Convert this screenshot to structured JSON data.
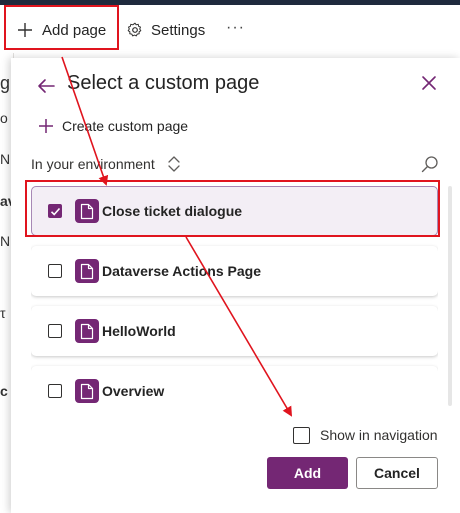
{
  "command_bar": {
    "add_page_label": "Add page",
    "settings_label": "Settings",
    "more_label": "···",
    "icons": {
      "add": "plus-icon",
      "settings": "gear-icon",
      "more": "ellipsis-icon"
    }
  },
  "background_fragments": [
    "g",
    "o",
    "N",
    "av",
    "N",
    "",
    "τ",
    "",
    "c"
  ],
  "panel": {
    "title": "Select a custom page",
    "create_label": "Create custom page",
    "environment_label": "In your environment",
    "icons": {
      "back": "back-arrow-icon",
      "close": "close-icon",
      "create": "plus-icon",
      "sort": "sort-icon",
      "search": "search-icon",
      "page": "page-icon"
    },
    "pages": [
      {
        "label": "Close ticket dialogue",
        "checked": true
      },
      {
        "label": "Dataverse Actions Page",
        "checked": false
      },
      {
        "label": "HelloWorld",
        "checked": false
      },
      {
        "label": "Overview",
        "checked": false
      }
    ],
    "show_in_navigation_label": "Show in navigation",
    "show_in_navigation_checked": false,
    "add_button_label": "Add",
    "cancel_button_label": "Cancel"
  },
  "colors": {
    "accent": "#742774",
    "callout": "#e0141e",
    "selected_row": "#f3eef5"
  }
}
